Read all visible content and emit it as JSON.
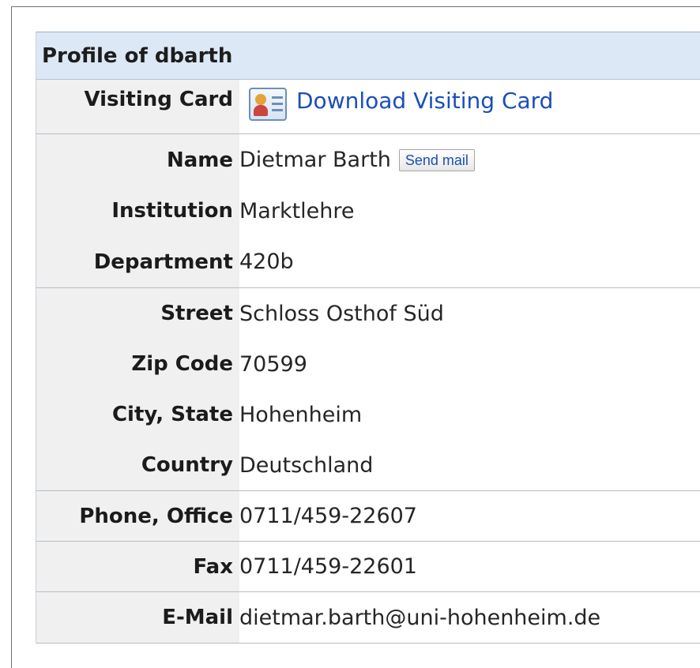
{
  "profile": {
    "title": "Profile of dbarth",
    "rows": [
      {
        "label": "Visiting Card",
        "value": "Download Visiting Card"
      },
      {
        "label": "Name",
        "value": "Dietmar Barth",
        "action": "Send mail"
      },
      {
        "label": "Institution",
        "value": "Marktlehre"
      },
      {
        "label": "Department",
        "value": "420b"
      },
      {
        "label": "Street",
        "value": "Schloss Osthof Süd"
      },
      {
        "label": "Zip Code",
        "value": "70599"
      },
      {
        "label": "City, State",
        "value": "Hohenheim"
      },
      {
        "label": "Country",
        "value": "Deutschland"
      },
      {
        "label": "Phone, Office",
        "value": "0711/459-22607"
      },
      {
        "label": "Fax",
        "value": "0711/459-22601"
      },
      {
        "label": "E-Mail",
        "value": "dietmar.barth@uni-hohenheim.de"
      }
    ]
  },
  "icons": {
    "visiting_card": "visiting-card-icon"
  }
}
